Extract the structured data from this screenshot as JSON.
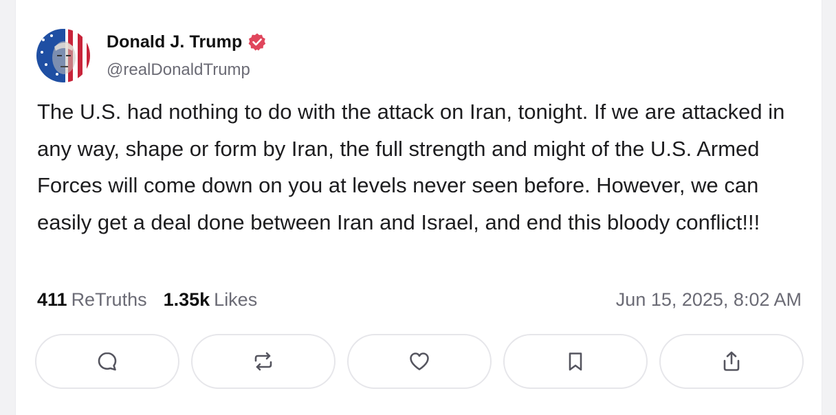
{
  "post": {
    "author": {
      "display_name": "Donald J. Trump",
      "handle": "@realDonaldTrump",
      "verified_icon": "verified-badge-icon",
      "accent_color": "#e0465c"
    },
    "text": "The U.S. had nothing to do with the attack on Iran, tonight. If we are attacked in any way, shape or form by Iran, the full strength and might of the U.S. Armed Forces will come down on you at levels never seen before. However, we can easily get a deal done between Iran and Israel, and end this bloody conflict!!!",
    "stats": {
      "retruths_count": "411",
      "retruths_label": "ReTruths",
      "likes_count": "1.35k",
      "likes_label": "Likes"
    },
    "timestamp": "Jun 15, 2025, 8:02 AM"
  },
  "actions": [
    {
      "icon": "reply-icon"
    },
    {
      "icon": "retruth-icon"
    },
    {
      "icon": "like-heart-icon"
    },
    {
      "icon": "bookmark-icon"
    },
    {
      "icon": "share-icon"
    }
  ]
}
